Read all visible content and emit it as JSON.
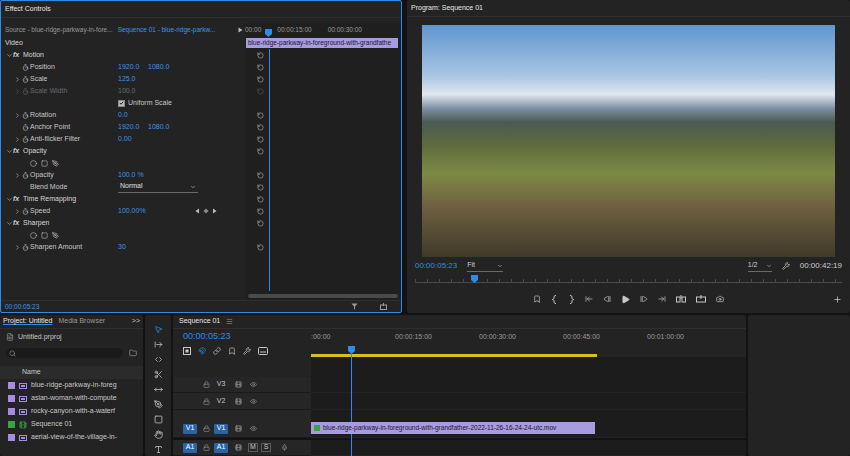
{
  "effect_controls": {
    "tab": "Effect Controls",
    "source": "Source - blue-ridge-parkway-in-fore...",
    "sequence": "Sequence 01 - blue-ridge-parkw...",
    "ruler": [
      "00:00",
      "00:00:15:00",
      "00:00:30:00"
    ],
    "clip": "blue-ridge-parkway-in-foreground-with-grandfathe",
    "section": "Video",
    "effects": [
      {
        "fx": "fx",
        "name": "Motion",
        "expanded": true,
        "properties": [
          {
            "kind": "value",
            "name": "Position",
            "values": [
              "1920.0",
              "1080.0"
            ],
            "expandable": false,
            "disabled": false
          },
          {
            "kind": "value",
            "name": "Scale",
            "values": [
              "125.0"
            ],
            "expandable": true,
            "disabled": false
          },
          {
            "kind": "value",
            "name": "Scale Width",
            "values": [
              "100.0"
            ],
            "expandable": true,
            "disabled": true
          },
          {
            "kind": "checkbox",
            "name": "Uniform Scale",
            "checked": true
          },
          {
            "kind": "value",
            "name": "Rotation",
            "values": [
              "0.0"
            ],
            "expandable": true,
            "disabled": false
          },
          {
            "kind": "value",
            "name": "Anchor Point",
            "values": [
              "1920.0",
              "1080.0"
            ],
            "expandable": false,
            "disabled": false
          },
          {
            "kind": "value",
            "name": "Anti-flicker Filter",
            "values": [
              "0.00"
            ],
            "expandable": true,
            "disabled": false
          }
        ]
      },
      {
        "fx": "fx",
        "name": "Opacity",
        "expanded": true,
        "properties": [
          {
            "kind": "masks"
          },
          {
            "kind": "value",
            "name": "Opacity",
            "values": [
              "100.0 %"
            ],
            "expandable": true,
            "disabled": false
          },
          {
            "kind": "dropdown",
            "name": "Blend Mode",
            "value": "Normal"
          }
        ]
      },
      {
        "fx": "fx",
        "name": "Time Remapping",
        "expanded": true,
        "properties": [
          {
            "kind": "keyframes",
            "name": "Speed",
            "values": [
              "100.00%"
            ],
            "expandable": true,
            "disabled": false
          }
        ]
      },
      {
        "fx": "fx",
        "name": "Sharpen",
        "expanded": true,
        "properties": [
          {
            "kind": "masks"
          },
          {
            "kind": "value",
            "name": "Sharpen Amount",
            "values": [
              "30"
            ],
            "expandable": true,
            "disabled": false
          }
        ]
      }
    ],
    "timecode": "00:00:05:23"
  },
  "program": {
    "title": "Program: Sequence 01",
    "timecode": "00:00:05:23",
    "zoom": "Fit",
    "resolution": "1/2",
    "duration": "00:00:42:19"
  },
  "project": {
    "tabs": [
      {
        "label": "Project: Untitled",
        "selected": true
      },
      {
        "label": "Media Browser",
        "selected": false
      }
    ],
    "overflow": ">>",
    "file": "Untitled.prproj",
    "column": "Name",
    "items": [
      {
        "name": "blue-ridge-parkway-in-foreg",
        "kind": "clip",
        "color": "#a58ce0"
      },
      {
        "name": "asian-woman-with-compute",
        "kind": "clip",
        "color": "#a58ce0"
      },
      {
        "name": "rocky-canyon-with-a-waterf",
        "kind": "clip",
        "color": "#a58ce0"
      },
      {
        "name": "Sequence 01",
        "kind": "sequence",
        "color": "#3aa14a"
      },
      {
        "name": "aerial-view-of-the-village-in-",
        "kind": "clip",
        "color": "#a58ce0"
      }
    ]
  },
  "tools": [
    {
      "selected": true
    },
    {
      "selected": false
    },
    {
      "selected": false
    },
    {
      "selected": false
    },
    {
      "selected": false
    },
    {
      "selected": false
    },
    {
      "selected": false
    },
    {
      "selected": false
    },
    {
      "selected": false
    }
  ],
  "timeline": {
    "tab": "Sequence 01",
    "timecode": "00:00:05:23",
    "ruler": [
      ":00:00",
      "00:00:15:00",
      "00:00:30:00",
      "00:00:45:00",
      "00:01:00:00"
    ],
    "tracks": [
      {
        "name": "V3",
        "kind": "video",
        "targeted": false
      },
      {
        "name": "V2",
        "kind": "video",
        "targeted": false
      },
      {
        "name": "V1",
        "kind": "video",
        "patch": "V1",
        "targeted": true
      },
      {
        "name": "A1",
        "kind": "audio",
        "patch": "A1",
        "targeted": true,
        "mute": "M",
        "solo": "S"
      }
    ],
    "clip": {
      "name": "blue-ridge-parkway-in-foreground-with-grandfather-2022-11-26-16-24-24-utc.mov",
      "track": "V1"
    }
  }
}
